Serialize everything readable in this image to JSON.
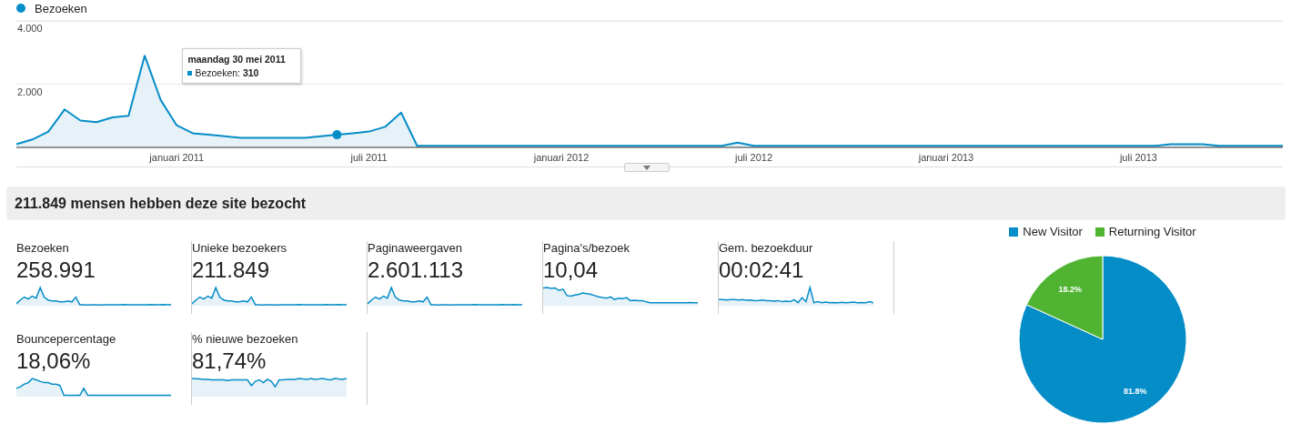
{
  "visits_chart": {
    "chart_data": {
      "type": "area",
      "legend": "top",
      "categories": [
        null,
        null,
        null,
        null,
        null,
        null,
        null,
        null,
        null,
        null,
        "januari 2011",
        null,
        null,
        null,
        null,
        null,
        null,
        null,
        null,
        null,
        null,
        null,
        "juli 2011",
        null,
        null,
        null,
        null,
        null,
        null,
        null,
        null,
        null,
        null,
        null,
        "januari 2012",
        null,
        null,
        null,
        null,
        null,
        null,
        null,
        null,
        null,
        null,
        null,
        "juli 2012",
        null,
        null,
        null,
        null,
        null,
        null,
        null,
        null,
        null,
        null,
        null,
        "januari 2013",
        null,
        null,
        null,
        null,
        null,
        null,
        null,
        null,
        null,
        null,
        null,
        "juli 2013",
        null,
        null,
        null,
        null,
        null,
        null,
        null,
        null,
        null
      ],
      "series": [
        {
          "name": "Bezoeken",
          "color": "#058dc7",
          "values": [
            100,
            250,
            500,
            1200,
            850,
            800,
            950,
            1000,
            2900,
            1500,
            700,
            450,
            400,
            350,
            300,
            300,
            300,
            300,
            300,
            350,
            400,
            450,
            500,
            650,
            1100,
            50,
            50,
            50,
            50,
            50,
            50,
            50,
            50,
            50,
            50,
            50,
            50,
            50,
            50,
            50,
            50,
            50,
            50,
            50,
            50,
            150,
            50,
            50,
            50,
            50,
            50,
            50,
            50,
            50,
            50,
            50,
            50,
            50,
            50,
            50,
            50,
            50,
            50,
            50,
            50,
            50,
            50,
            50,
            50,
            50,
            50,
            50,
            100,
            100,
            100,
            50,
            50,
            50,
            50,
            50
          ]
        }
      ],
      "ylim": [
        0,
        4000
      ],
      "yticks": [
        {
          "value": 2000,
          "label": "2.000"
        },
        {
          "value": 4000,
          "label": "4.000"
        }
      ]
    }
  },
  "tooltip": {
    "date": "maandag 30 mei 2011",
    "text": "Bezoeken: **310**"
  },
  "summary": "211.849 mensen hebben deze site bezocht",
  "metrics": [
    {
      "label": "Bezoeken",
      "value": "258.991"
    },
    {
      "label": "Unieke bezoekers",
      "value": "211.849"
    },
    {
      "label": "Paginaweergaven",
      "value": "2.601.113"
    },
    {
      "label": "Pagina's/bezoek",
      "value": "10,04"
    },
    {
      "label": "Gem. bezoekduur",
      "value": "00:02:41"
    },
    {
      "label": "Bouncepercentage",
      "value": "18,06%"
    },
    {
      "label": "% nieuwe bezoeken",
      "value": "81,74%"
    }
  ],
  "visitor_chart": {
    "chart_data": {
      "type": "pie",
      "legend": "top",
      "categories": [
        "New Visitor",
        "Returning Visitor"
      ],
      "values": [
        81.8,
        18.2
      ],
      "colors": [
        "#058dc7",
        "#50b432"
      ],
      "value_labels": [
        "81.8%",
        "18.2%"
      ]
    }
  }
}
